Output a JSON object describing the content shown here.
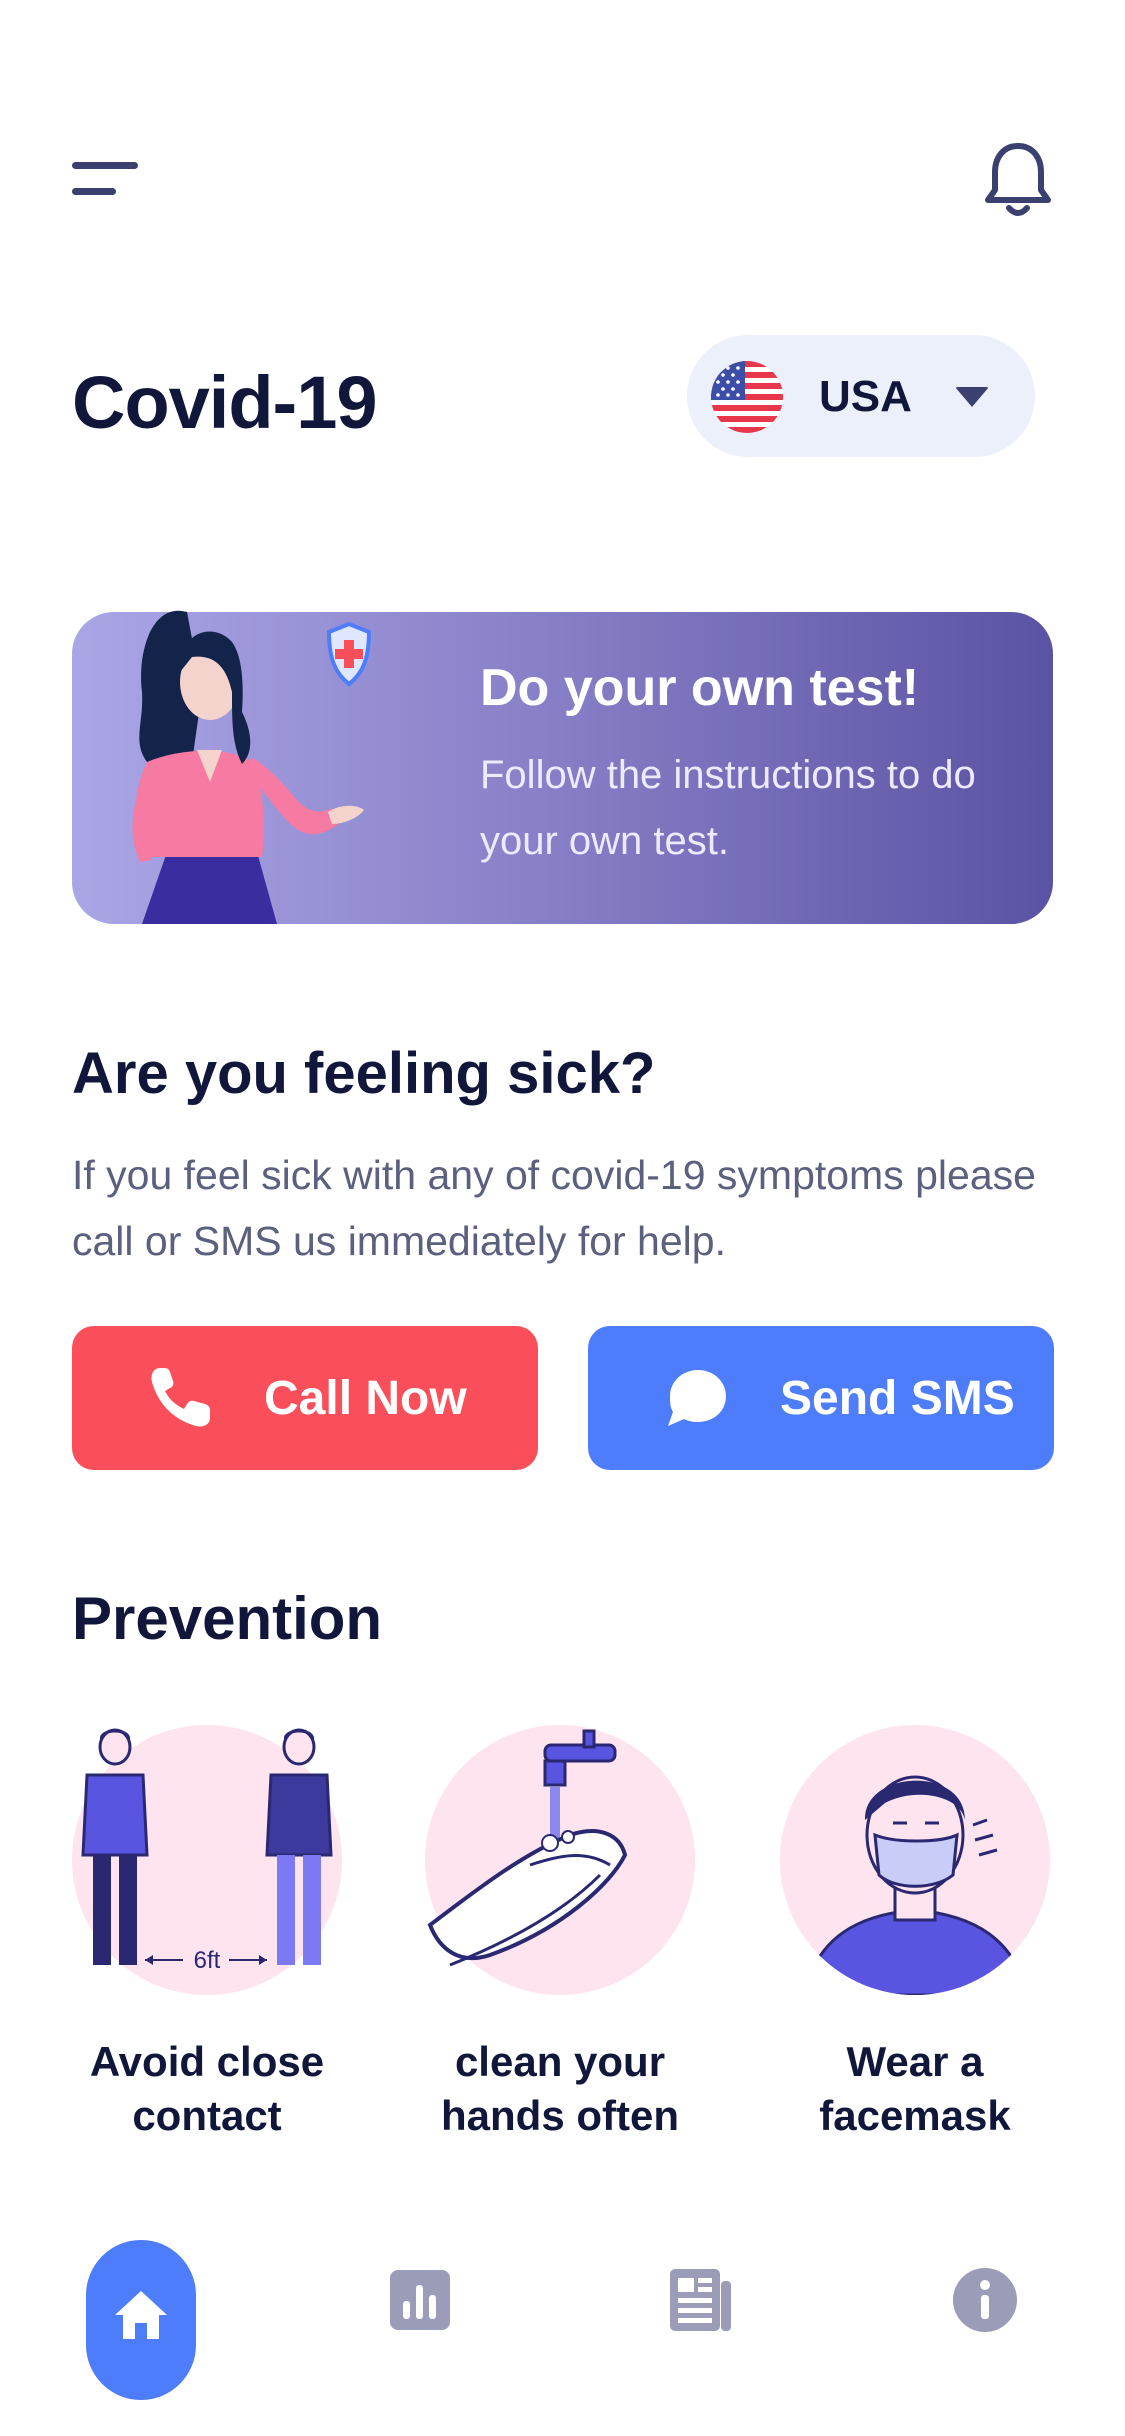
{
  "header": {
    "menu_icon": "hamburger-menu-icon",
    "bell_icon": "bell-icon",
    "title": "Covid-19",
    "country": {
      "name": "USA",
      "flag_icon": "us-flag-icon",
      "dropdown_icon": "caret-down-icon"
    }
  },
  "banner": {
    "title": "Do your own test!",
    "text": "Follow the instructions to do your own test.",
    "gradient": [
      "#aaa6e6",
      "#5a53a3"
    ]
  },
  "sick": {
    "title": "Are you feeling sick?",
    "text": "If you feel sick with any of covid-19 symptoms please call or SMS us immediately for help."
  },
  "actions": {
    "call": {
      "label": "Call Now",
      "icon": "phone-icon",
      "color": "#fa4e5b"
    },
    "sms": {
      "label": "Send SMS",
      "icon": "chat-bubble-icon",
      "color": "#4e7dfb"
    }
  },
  "prevention": {
    "title": "Prevention",
    "items": [
      {
        "label": "Avoid close contact",
        "distance_label": "6ft"
      },
      {
        "label": "clean your hands often"
      },
      {
        "label": "Wear a facemask"
      }
    ]
  },
  "nav": {
    "items": [
      {
        "icon": "home-icon",
        "active": true
      },
      {
        "icon": "stats-icon",
        "active": false
      },
      {
        "icon": "news-icon",
        "active": false
      },
      {
        "icon": "info-icon",
        "active": false
      }
    ],
    "active_color": "#4e7dfb",
    "inactive_color": "#9a9cb8"
  }
}
